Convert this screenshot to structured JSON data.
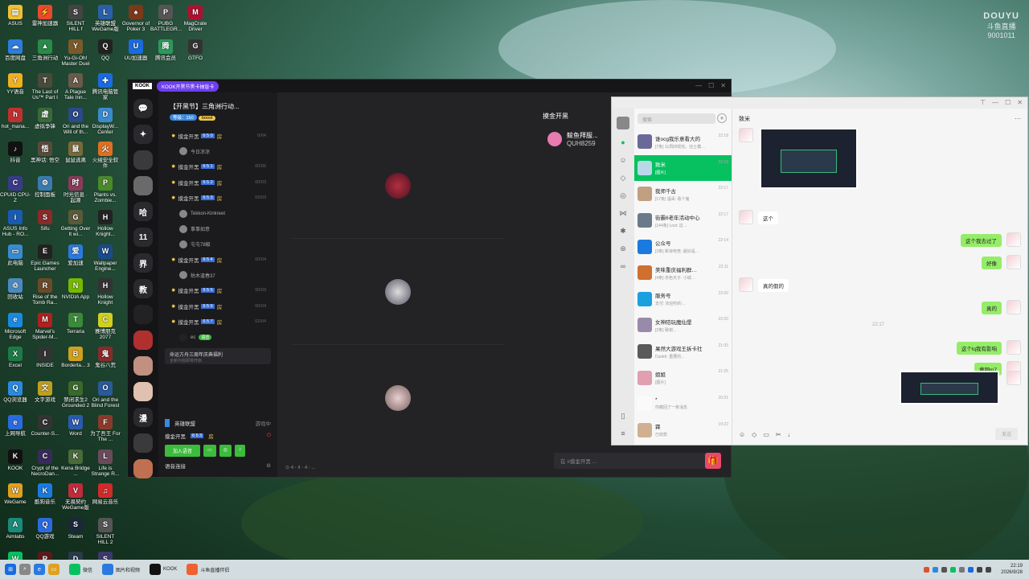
{
  "desktop": {
    "icons": [
      {
        "label": "ASUS",
        "color": "#f0c030",
        "glyph": "▤"
      },
      {
        "label": "雷神加速器",
        "color": "#e84a2a",
        "glyph": "⚡"
      },
      {
        "label": "SILENT HILL f",
        "color": "#444",
        "glyph": "S"
      },
      {
        "label": "英雄联盟 WeGame版",
        "color": "#2a5fa8",
        "glyph": "L"
      },
      {
        "label": "Governor of Poker 3",
        "color": "#7a3a1a",
        "glyph": "♠"
      },
      {
        "label": "PUBG BATTLEGR...",
        "color": "#555",
        "glyph": "P"
      },
      {
        "label": "MagCrate Driver",
        "color": "#b01030",
        "glyph": "M"
      },
      {
        "label": "百度网盘",
        "color": "#2e7ce0",
        "glyph": "☁"
      },
      {
        "label": "三角洲行动",
        "color": "#2a8a4a",
        "glyph": "▲"
      },
      {
        "label": "Yu-Gi-Oh! Master Duel",
        "color": "#7a5a2a",
        "glyph": "Y"
      },
      {
        "label": "QQ",
        "color": "#222",
        "glyph": "Q"
      },
      {
        "label": "UU加速器",
        "color": "#1a6ae0",
        "glyph": "U"
      },
      {
        "label": "腾讯会员",
        "color": "#2a9a5a",
        "glyph": "腾"
      },
      {
        "label": "GTFO",
        "color": "#333",
        "glyph": "G"
      },
      {
        "label": "YY语音",
        "color": "#f0b020",
        "glyph": "Y"
      },
      {
        "label": "The Last of Us™ Part I",
        "color": "#4a4a3a",
        "glyph": "T"
      },
      {
        "label": "A Plague Tale Inn...",
        "color": "#6a5a4a",
        "glyph": "A"
      },
      {
        "label": "腾讯电脑管家",
        "color": "#1a6ae0",
        "glyph": "✚"
      },
      {
        "label": "hot_mana...",
        "color": "#c03030",
        "glyph": "h"
      },
      {
        "label": "虚拟争锋",
        "color": "#3a6a3a",
        "glyph": "虚"
      },
      {
        "label": "Ori and the Will of th...",
        "color": "#2a4a8a",
        "glyph": "O"
      },
      {
        "label": "DisplayW... Center",
        "color": "#3a8ad0",
        "glyph": "D"
      },
      {
        "label": "抖音",
        "color": "#111",
        "glyph": "♪"
      },
      {
        "label": "黑神话: 悟空",
        "color": "#5a4a3a",
        "glyph": "悟"
      },
      {
        "label": "鼠鼠逃离",
        "color": "#7a6a3a",
        "glyph": "鼠"
      },
      {
        "label": "火绒安全软件",
        "color": "#e07020",
        "glyph": "火"
      },
      {
        "label": "CPUID CPU-Z",
        "color": "#3a3a8a",
        "glyph": "C"
      },
      {
        "label": "控制面板",
        "color": "#3a7ab0",
        "glyph": "⚙"
      },
      {
        "label": "时光信息 · 起源",
        "color": "#8a3a5a",
        "glyph": "时"
      },
      {
        "label": "Plants vs. Zombie...",
        "color": "#4a8a2a",
        "glyph": "P"
      },
      {
        "label": "ASUS Info Hub - RO...",
        "color": "#1a5ab0",
        "glyph": "i"
      },
      {
        "label": "Sifu",
        "color": "#8a2a2a",
        "glyph": "S"
      },
      {
        "label": "Getting Over It wi...",
        "color": "#5a5a3a",
        "glyph": "G"
      },
      {
        "label": "Hollow Knight...",
        "color": "#222",
        "glyph": "H"
      },
      {
        "label": "此电脑",
        "color": "#3a8ad0",
        "glyph": "▭"
      },
      {
        "label": "Epic Games Launcher",
        "color": "#222",
        "glyph": "E"
      },
      {
        "label": "爱加速",
        "color": "#2a7ae0",
        "glyph": "爱"
      },
      {
        "label": "Wallpaper Engine...",
        "color": "#1a4a8a",
        "glyph": "W"
      },
      {
        "label": "回收站",
        "color": "#4a8ac0",
        "glyph": "♲"
      },
      {
        "label": "Rise of the Tomb Ra...",
        "color": "#6a4a2a",
        "glyph": "R"
      },
      {
        "label": "NVIDIA App",
        "color": "#76b900",
        "glyph": "N"
      },
      {
        "label": "Hollow Knight",
        "color": "#333",
        "glyph": "H"
      },
      {
        "label": "Microsoft Edge",
        "color": "#1a8ae0",
        "glyph": "e"
      },
      {
        "label": "Marvel's Spider-M...",
        "color": "#b02020",
        "glyph": "M"
      },
      {
        "label": "Terraria",
        "color": "#3a8a3a",
        "glyph": "T"
      },
      {
        "label": "赛博朋克 2077",
        "color": "#d0d020",
        "glyph": "C"
      },
      {
        "label": "Excel",
        "color": "#1e7a45",
        "glyph": "X"
      },
      {
        "label": "INSIDE",
        "color": "#333",
        "glyph": "I"
      },
      {
        "label": "Borderla... 3",
        "color": "#d0a020",
        "glyph": "B"
      },
      {
        "label": "鬼谷八荒",
        "color": "#8a2a2a",
        "glyph": "鬼"
      },
      {
        "label": "QQ浏览器",
        "color": "#2a8ae0",
        "glyph": "Q"
      },
      {
        "label": "文字游戏",
        "color": "#c0a020",
        "glyph": "文"
      },
      {
        "label": "禁闭求生2 Grounded 2",
        "color": "#3a6a2a",
        "glyph": "G"
      },
      {
        "label": "Ori and the Blind Forest",
        "color": "#2a5a9a",
        "glyph": "O"
      },
      {
        "label": "上网导航",
        "color": "#2a6ae0",
        "glyph": "e"
      },
      {
        "label": "Counter-S...",
        "color": "#333",
        "glyph": "C"
      },
      {
        "label": "Word",
        "color": "#2a5ab0",
        "glyph": "W"
      },
      {
        "label": "为了吾王 For The ...",
        "color": "#8a3a2a",
        "glyph": "F"
      },
      {
        "label": "KOOK",
        "color": "#111",
        "glyph": "K"
      },
      {
        "label": "Crypt of the NecroDan...",
        "color": "#3a2a5a",
        "glyph": "C"
      },
      {
        "label": "Kena Bridge ...",
        "color": "#4a6a3a",
        "glyph": "K"
      },
      {
        "label": "Life is Strange R...",
        "color": "#6a4a5a",
        "glyph": "L"
      },
      {
        "label": "WeGame",
        "color": "#e0a020",
        "glyph": "W"
      },
      {
        "label": "酷狗音乐",
        "color": "#1a7ae0",
        "glyph": "K"
      },
      {
        "label": "无畏契约 WeGame版",
        "color": "#c02a3a",
        "glyph": "V"
      },
      {
        "label": "网易云音乐",
        "color": "#d02a2a",
        "glyph": "♫"
      },
      {
        "label": "Aimlabs",
        "color": "#1a8a7a",
        "glyph": "A"
      },
      {
        "label": "QQ游戏",
        "color": "#2a6ae0",
        "glyph": "Q"
      },
      {
        "label": "Steam",
        "color": "#1b2838",
        "glyph": "S"
      },
      {
        "label": "SILENT HILL 2",
        "color": "#555",
        "glyph": "S"
      },
      {
        "label": "微信",
        "color": "#07c160",
        "glyph": "W"
      },
      {
        "label": "Resident Evil Re...",
        "color": "#5a1a1a",
        "glyph": "R"
      },
      {
        "label": "DEATH STRANDI...",
        "color": "#2a3a4a",
        "glyph": "D"
      },
      {
        "label": "Street Fighter 6",
        "color": "#3a3a6a",
        "glyph": "S"
      }
    ]
  },
  "douyu": {
    "brand": "DOUYU",
    "sub": "斗鱼直播",
    "room": "9001011"
  },
  "kook": {
    "logo": "KOOK",
    "promo": "KOOK开黑节黑卡抽盲卡",
    "server_icons": [
      "💬",
      "✦",
      "",
      "",
      "哈",
      "11",
      "界",
      "教",
      "",
      "",
      "",
      "",
      "漫",
      "",
      ""
    ],
    "channel_header": {
      "title": "【开黑节】三角洲行动...",
      "tag1": "等级：150",
      "tag2": "boost"
    },
    "channels": [
      {
        "name": "摸金开黑",
        "num": "6 5 0",
        "room": "房",
        "count": "0/04",
        "members": [
          "今日凉凉"
        ]
      },
      {
        "name": "摸金开黑",
        "num": "6 5 1",
        "room": "房",
        "count": "00/06",
        "members": []
      },
      {
        "name": "摸金开黑",
        "num": "6 5 2",
        "room": "房",
        "count": "00/03",
        "members": []
      },
      {
        "name": "摸金开黑",
        "num": "6 5 3",
        "room": "房",
        "count": "03/03",
        "members": [
          "Tekkon-Kinkreet",
          "事事如意",
          "屯屯78級"
        ]
      },
      {
        "name": "摸金开黑",
        "num": "6 5 4",
        "room": "房",
        "count": "00/04",
        "members": [
          "枯木逢春37"
        ]
      },
      {
        "name": "摸金开黑",
        "num": "6 5 5",
        "room": "房",
        "count": "00/03",
        "members": []
      },
      {
        "name": "摸金开黑",
        "num": "6 5 6",
        "room": "房",
        "count": "00/04",
        "members": []
      },
      {
        "name": "摸金开黑",
        "num": "6 5 7",
        "room": "房",
        "count": "02/04",
        "members": []
      }
    ],
    "extra_member": {
      "name": "ec",
      "badge": "语音"
    },
    "voice_card": {
      "title": "命运方舟三周年庆典福利",
      "sub": "全新内容即将开启"
    },
    "game_status": {
      "name": "英雄联盟",
      "state": "游戏中"
    },
    "current_room": {
      "label": "摸金开黑",
      "num": "6 5 3",
      "room": "房"
    },
    "join_button": "加入语音",
    "footer_label": "语音连接",
    "chat_title": "摸金开黑",
    "profile": {
      "name": "鲸鱼拜服...",
      "id": "QUH8259"
    },
    "input_placeholder": "在 #摸金开黑 ...",
    "voice_count": "⊙ 4 ⋅ 4 ⋅ 4 ⋅ ..."
  },
  "wechat": {
    "search_placeholder": "搜索",
    "chat_title": "致米",
    "conversations": [
      {
        "name": "谁ocg我乐意看大的",
        "preview": "[7条] 11周四现完，还士模…",
        "time": "22:18",
        "color": "#6a6a9a"
      },
      {
        "name": "致米",
        "preview": "[图片]",
        "time": "22:18",
        "color": "#b8d8e8",
        "active": true
      },
      {
        "name": "我师千古",
        "preview": "[17条] 温哥: 看个鬼",
        "time": "22:17",
        "color": "#c0a080"
      },
      {
        "name": "街霸6老年活动中心",
        "preview": "[144条] Lost: 这…",
        "time": "22:17",
        "color": "#6a7a8a"
      },
      {
        "name": "公众号",
        "preview": "[3条] 新浪电竞: 最好是…",
        "time": "22:14",
        "color": "#1a7ae0"
      },
      {
        "name": "美味重庆福利群…",
        "preview": "[4条] 赤色天子: 小城…",
        "time": "22:11",
        "color": "#d07030"
      },
      {
        "name": "服务号",
        "preview": "支付: 欢迎你的…",
        "time": "22:00",
        "color": "#1aa0e0"
      },
      {
        "name": "女神陪玩魔仙堡",
        "preview": "[2条] 致谢…",
        "time": "22:00",
        "color": "#9a8aaa"
      },
      {
        "name": "果然大游戏王拆卡社",
        "preview": "Dunkh: 重要的…",
        "time": "21:05",
        "color": "#5a5a5a"
      },
      {
        "name": "姐姐",
        "preview": "[图片]",
        "time": "21:25",
        "color": "#e0a0b0"
      },
      {
        "name": "*",
        "preview": "你撤回了一条消息",
        "time": "20:31",
        "color": "#fafafa"
      },
      {
        "name": "霖",
        "preview": "已收款",
        "time": "19:22",
        "color": "#d0b090"
      }
    ],
    "messages": [
      {
        "side": "left",
        "text": "这个"
      },
      {
        "side": "right",
        "text": "这个我去过了"
      },
      {
        "side": "right",
        "text": "好像"
      },
      {
        "side": "left",
        "text": "真的假的"
      },
      {
        "side": "right",
        "text": "真的"
      },
      {
        "side": "right",
        "text": "这个lq我有影响"
      },
      {
        "side": "right",
        "text": "黄铜m7"
      }
    ],
    "time_divider": "22:17",
    "send_label": "发送"
  },
  "taskbar": {
    "apps": [
      {
        "label": "微信",
        "color": "#07c160"
      },
      {
        "label": "图片和视频",
        "color": "#2a7ae0"
      },
      {
        "label": "KOOK",
        "color": "#111"
      },
      {
        "label": "斗鱼直播伴侣",
        "color": "#f06030"
      }
    ],
    "time": "22:19",
    "date": "2026/9/28"
  }
}
